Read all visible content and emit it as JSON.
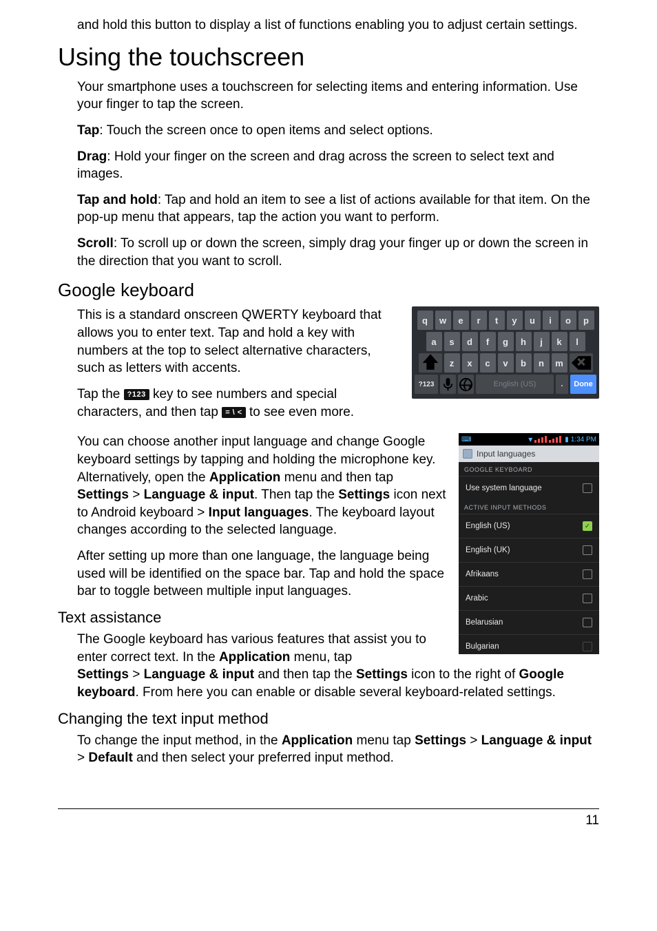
{
  "intro_continuation": "and hold this button to display a list of functions enabling you to adjust certain settings.",
  "section_touchscreen": {
    "heading": "Using the touchscreen",
    "intro": "Your smartphone uses a touchscreen for selecting items and entering information. Use your finger to tap the screen.",
    "tap_label": "Tap",
    "tap_text": ": Touch the screen once to open items and select options.",
    "drag_label": "Drag",
    "drag_text": ": Hold your finger on the screen and drag across the screen to select text and images.",
    "tap_hold_label": "Tap and hold",
    "tap_hold_text": ": Tap and hold an item to see a list of actions available for that item. On the pop-up menu that appears, tap the action you want to perform.",
    "scroll_label": "Scroll",
    "scroll_text": ": To scroll up or down the screen, simply drag your finger up or down the screen in the direction that you want to scroll."
  },
  "section_google_kb": {
    "heading": "Google keyboard",
    "p1": "This is a standard onscreen QWERTY keyboard that allows you to enter text. Tap and hold a key with numbers at the top to select alternative characters, such as letters with accents.",
    "p2_a": "Tap the ",
    "key_123": "?123",
    "p2_b": " key to see numbers and special characters, and then tap ",
    "key_sym": "= \\ <",
    "p2_c": " to see even more.",
    "p3_a": "You can choose another input language and change Google keyboard settings by tapping and holding the microphone key. Alternatively, open the ",
    "p3_app": "Application",
    "p3_b": " menu and then tap ",
    "p3_settings": "Settings",
    "p3_gt1": " > ",
    "p3_lang": "Language & input",
    "p3_c": ". Then tap the ",
    "p3_settings2": "Settings",
    "p3_d": " icon next to Android keyboard > ",
    "p3_inputlang": "Input languages",
    "p3_e": ". The keyboard layout changes according to the selected language.",
    "p4": "After setting up more than one language, the language being used will be identified on the space bar. Tap and hold the space bar to toggle between multiple input languages."
  },
  "keyboard": {
    "row1": [
      "q",
      "w",
      "e",
      "r",
      "t",
      "y",
      "u",
      "i",
      "o",
      "p"
    ],
    "row2": [
      "a",
      "s",
      "d",
      "f",
      "g",
      "h",
      "j",
      "k",
      "l"
    ],
    "row3_shift": "⇧",
    "row3": [
      "z",
      "x",
      "c",
      "v",
      "b",
      "n",
      "m"
    ],
    "row3_bksp": "⌫",
    "row4_sym": "?123",
    "row4_mic": "mic",
    "row4_globe": "globe",
    "row4_space": "English (US)",
    "row4_period": ".",
    "row4_done": "Done"
  },
  "lang_panel": {
    "status_time": "1:34 PM",
    "header": "Input languages",
    "section_kb": "GOOGLE KEYBOARD",
    "use_system": "Use system language",
    "section_active": "ACTIVE INPUT METHODS",
    "items": [
      {
        "label": "English (US)",
        "checked": true
      },
      {
        "label": "English (UK)",
        "checked": false
      },
      {
        "label": "Afrikaans",
        "checked": false
      },
      {
        "label": "Arabic",
        "checked": false
      },
      {
        "label": "Belarusian",
        "checked": false
      },
      {
        "label": "Bulgarian",
        "checked": false
      }
    ]
  },
  "section_text_assist": {
    "heading": "Text assistance",
    "p1_a": "The Google keyboard has various features that assist you to enter correct text. In the ",
    "p1_app": "Application",
    "p1_b": " menu, tap ",
    "p1_settings": "Settings",
    "p1_gt1": " > ",
    "p1_lang": "Language & input",
    "p1_c": " and then tap the ",
    "p1_settings2": "Settings",
    "p1_d": " icon to the right of ",
    "p1_gk": "Google keyboard",
    "p1_e": ". From here you can enable or disable several keyboard-related settings."
  },
  "section_change_input": {
    "heading": "Changing the text input method",
    "p1_a": "To change the input method, in the ",
    "p1_app": "Application",
    "p1_b": " menu tap ",
    "p1_settings": "Settings",
    "p1_gt1": " > ",
    "p1_lang": "Language & input",
    "p1_gt2": " > ",
    "p1_default": "Default",
    "p1_c": " and then select your preferred input method."
  },
  "page_number": "11"
}
